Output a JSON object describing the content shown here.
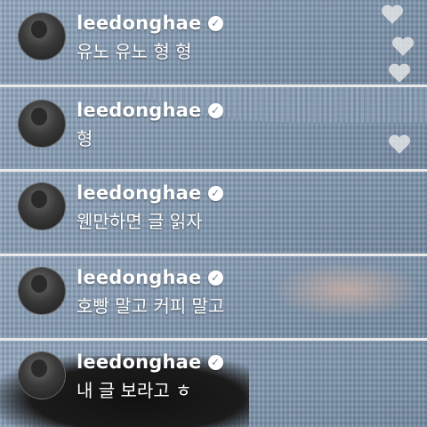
{
  "panels": [
    {
      "username": "leedonghae",
      "message": "유노 유노 형 형"
    },
    {
      "username": "leedonghae",
      "message": "형"
    },
    {
      "username": "leedonghae",
      "message": "웬만하면 글 읽자"
    },
    {
      "username": "leedonghae",
      "message": "호빵 말고 커피 말고"
    },
    {
      "username": "leedonghae",
      "message": "내 글 보라고 ㅎ"
    }
  ],
  "icons": {
    "verified": "verified-badge-icon",
    "heart": "heart-icon",
    "avatar": "profile-avatar"
  },
  "colors": {
    "sweater": "#8fa4bb",
    "text": "#ffffff",
    "badge": "#ffffff"
  }
}
